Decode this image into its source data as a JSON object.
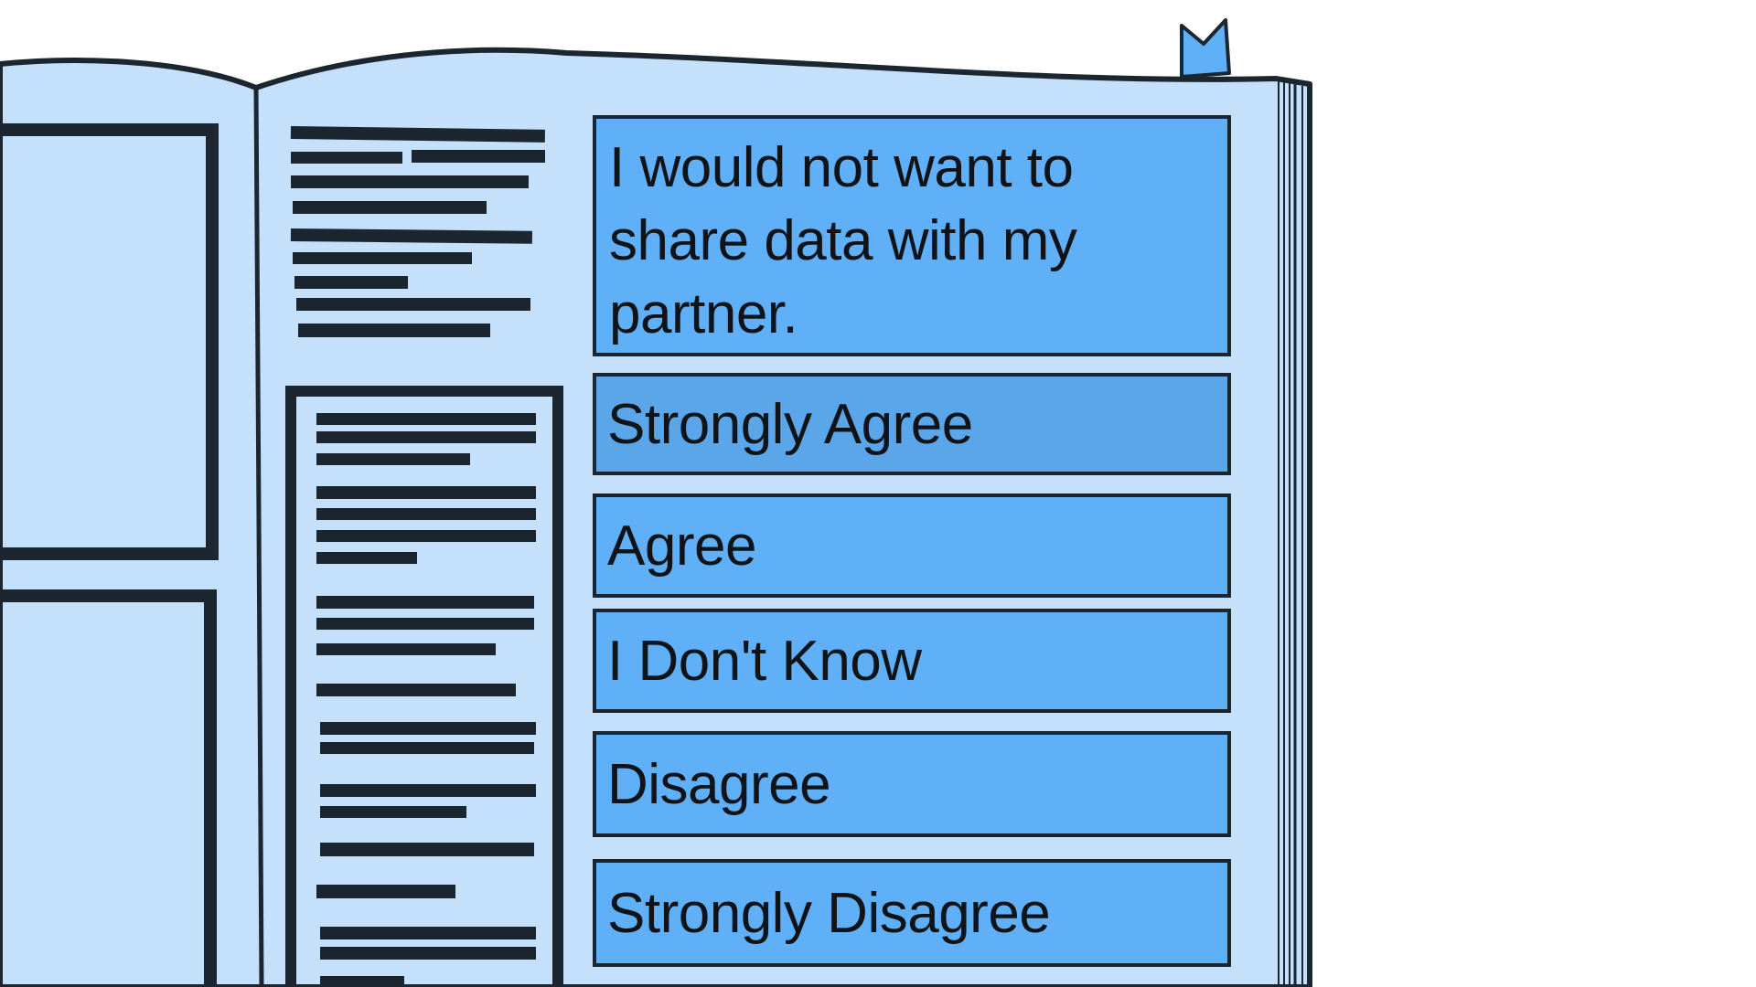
{
  "survey": {
    "question": "I would not want to share data with my partner.",
    "options": [
      {
        "label": "Strongly Agree",
        "selected": true
      },
      {
        "label": "Agree",
        "selected": false
      },
      {
        "label": "I Don't Know",
        "selected": false
      },
      {
        "label": "Disagree",
        "selected": false
      },
      {
        "label": "Strongly Disagree",
        "selected": false
      }
    ]
  },
  "colors": {
    "page": "#c4e0fa",
    "ink": "#1c2630",
    "button": "#60b0f8",
    "button_selected": "#5aa6e8",
    "background": "#ffffff"
  }
}
